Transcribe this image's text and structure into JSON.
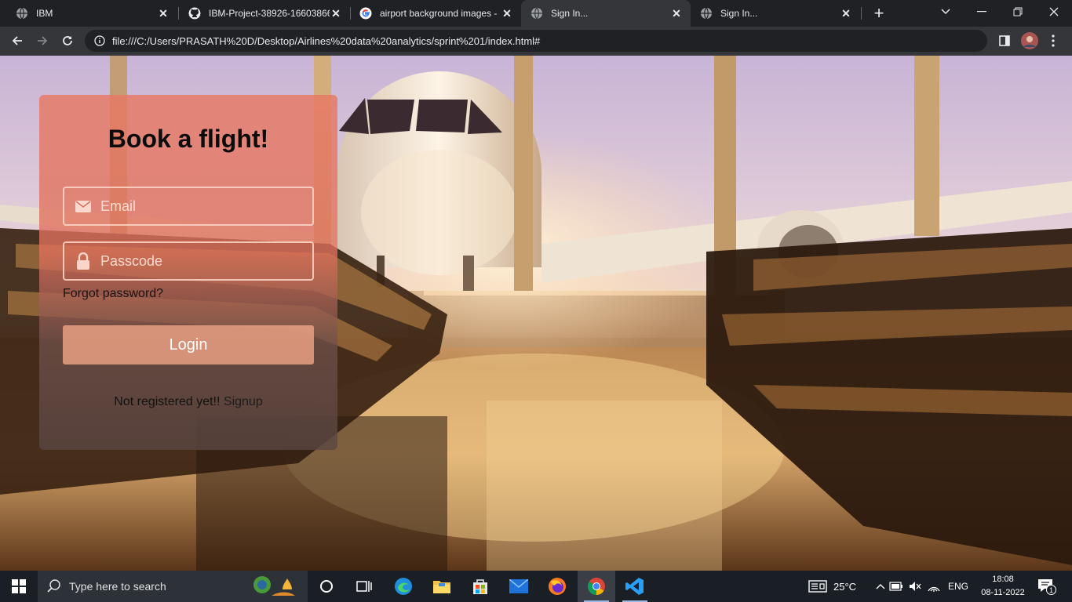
{
  "browser": {
    "tabs": [
      {
        "title": "IBM",
        "favicon": "globe-icon",
        "active": false
      },
      {
        "title": "IBM-Project-38926-16603866",
        "favicon": "github-icon",
        "active": false
      },
      {
        "title": "airport background images -",
        "favicon": "google-icon",
        "active": false
      },
      {
        "title": "Sign In...",
        "favicon": "globe-icon",
        "active": true
      },
      {
        "title": "Sign In...",
        "favicon": "globe-icon",
        "active": false
      }
    ],
    "address": "file:///C:/Users/PRASATH%20D/Desktop/Airlines%20data%20analytics/sprint%201/index.html#"
  },
  "page": {
    "heading": "Book a flight!",
    "email_placeholder": "Email",
    "passcode_placeholder": "Passcode",
    "forgot_label": "Forgot password?",
    "login_label": "Login",
    "not_registered": "Not registered yet!!",
    "signup_label": "Signup"
  },
  "taskbar": {
    "search_placeholder": "Type here to search",
    "weather": "25°C",
    "language": "ENG",
    "time": "18:08",
    "date": "08-11-2022",
    "notifications": "1"
  },
  "colors": {
    "card_top": "#e87864",
    "login_button": "#e9a082",
    "browser_dark": "#202124",
    "toolbar": "#35363a"
  }
}
